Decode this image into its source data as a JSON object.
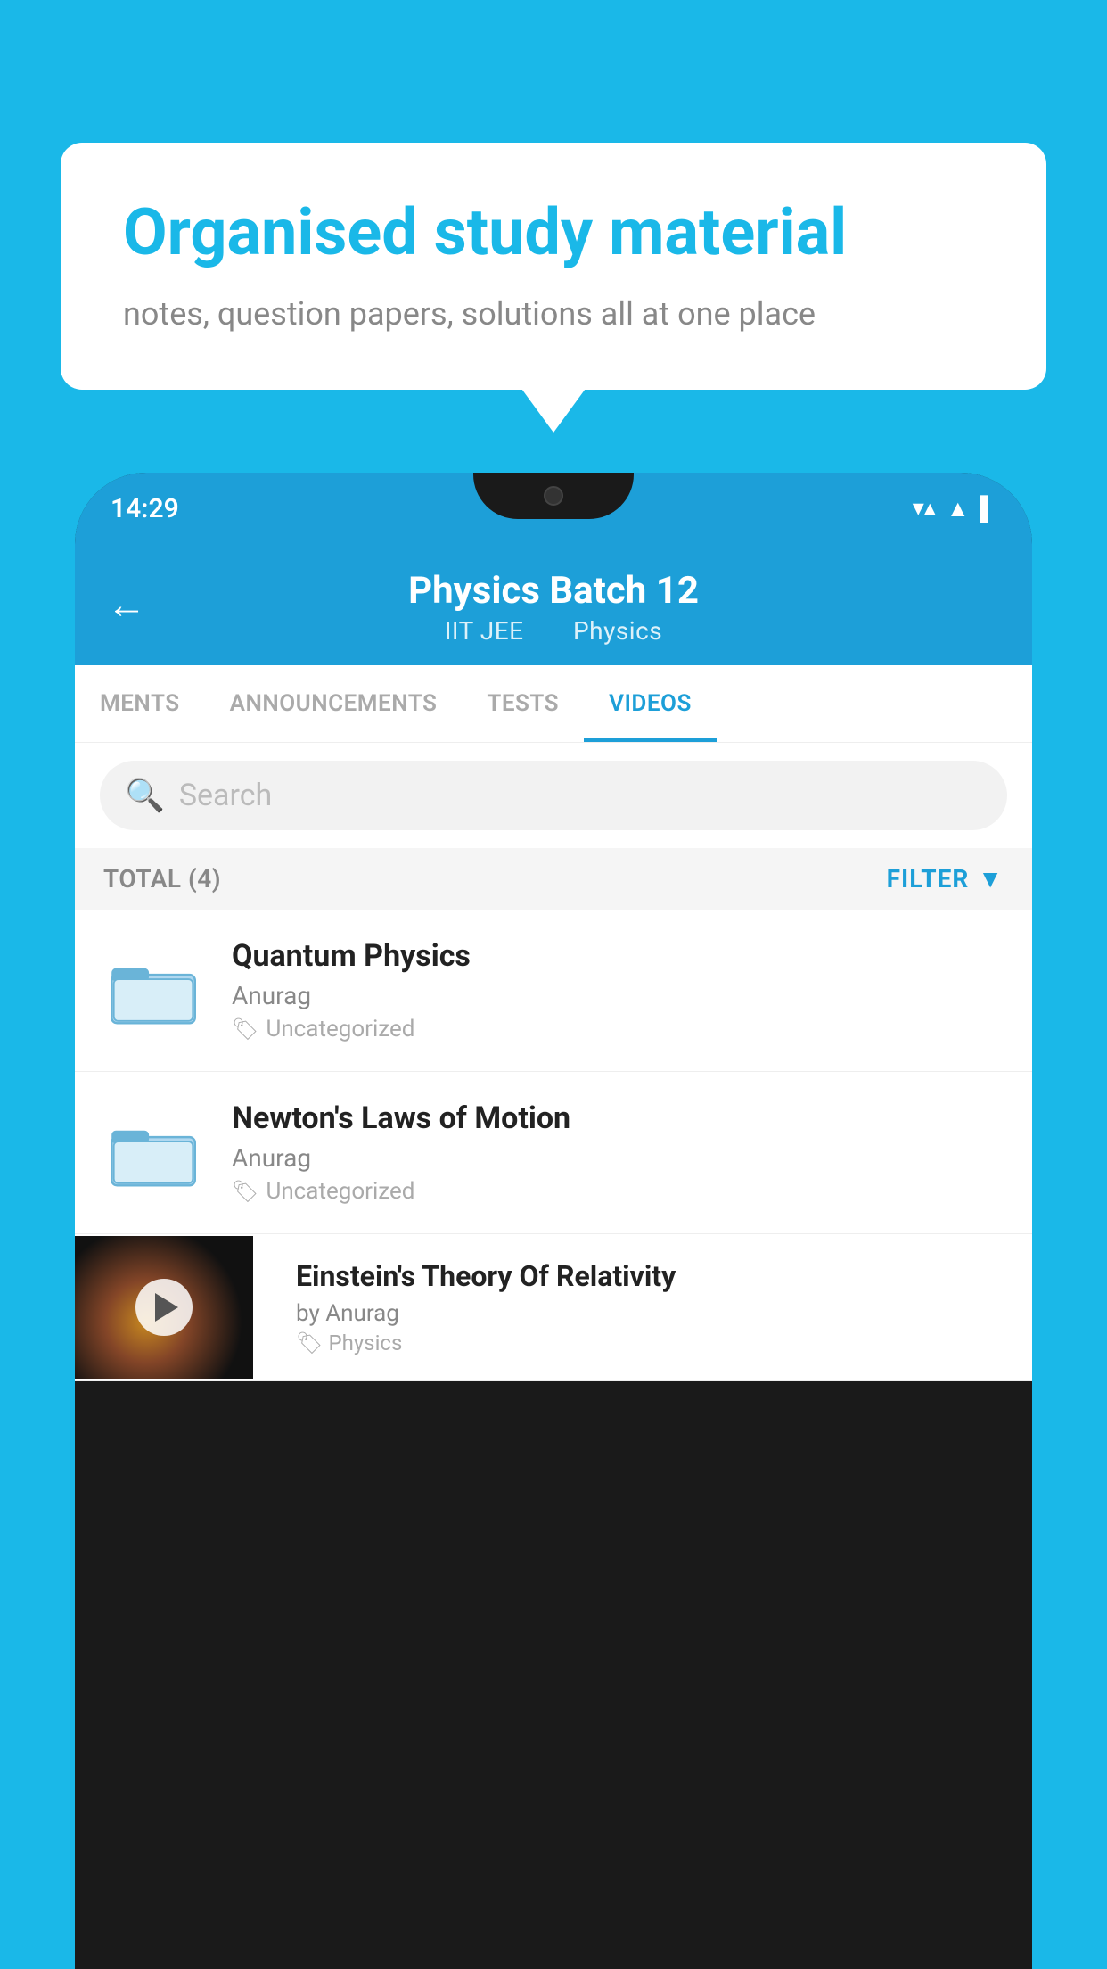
{
  "background": {
    "color": "#1ab8e8"
  },
  "speech_bubble": {
    "title": "Organised study material",
    "subtitle": "notes, question papers, solutions all at one place"
  },
  "status_bar": {
    "time": "14:29",
    "icons": [
      "▼▲",
      "▲",
      "▌"
    ]
  },
  "header": {
    "back_label": "←",
    "title": "Physics Batch 12",
    "subtitle_left": "IIT JEE",
    "subtitle_right": "Physics"
  },
  "tabs": [
    {
      "label": "MENTS",
      "active": false
    },
    {
      "label": "ANNOUNCEMENTS",
      "active": false
    },
    {
      "label": "TESTS",
      "active": false
    },
    {
      "label": "VIDEOS",
      "active": true
    }
  ],
  "search": {
    "placeholder": "Search"
  },
  "filter_row": {
    "total_label": "TOTAL (4)",
    "filter_label": "FILTER"
  },
  "videos": [
    {
      "id": 1,
      "title": "Quantum Physics",
      "author": "Anurag",
      "tag": "Uncategorized",
      "has_thumb": false
    },
    {
      "id": 2,
      "title": "Newton's Laws of Motion",
      "author": "Anurag",
      "tag": "Uncategorized",
      "has_thumb": false
    },
    {
      "id": 3,
      "title": "Einstein's Theory Of Relativity",
      "author": "by Anurag",
      "tag": "Physics",
      "has_thumb": true
    }
  ]
}
